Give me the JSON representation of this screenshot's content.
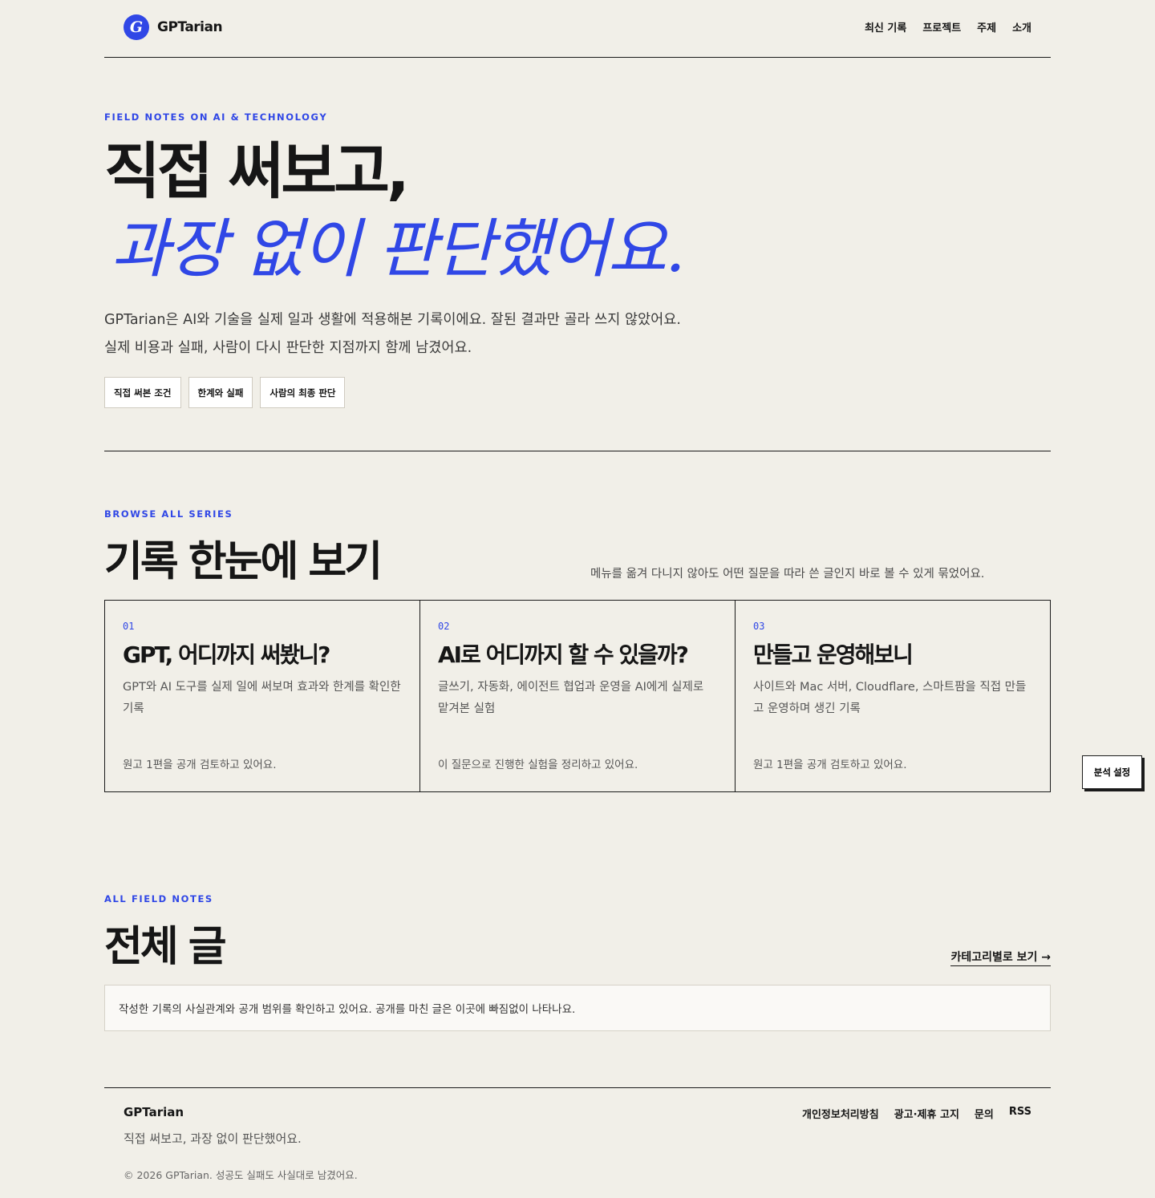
{
  "brand": {
    "logo_letter": "G",
    "name": "GPTarian",
    "accent": "#3047e6"
  },
  "nav": [
    "최신 기록",
    "프로젝트",
    "주제",
    "소개"
  ],
  "hero": {
    "eyebrow": "FIELD NOTES ON AI & TECHNOLOGY",
    "title_line1": "직접 써보고,",
    "title_line2": "과장 없이 판단했어요.",
    "desc_line1": "GPTarian은 AI와 기술을 실제 일과 생활에 적용해본 기록이에요. 잘된 결과만 골라 쓰지 않았어요.",
    "desc_line2": "실제 비용과 실패, 사람이 다시 판단한 지점까지 함께 남겼어요.",
    "chips": [
      "직접 써본 조건",
      "한계와 실패",
      "사람의 최종 판단"
    ]
  },
  "series": {
    "eyebrow": "BROWSE ALL SERIES",
    "title": "기록 한눈에 보기",
    "note": "메뉴를 옮겨 다니지 않아도 어떤 질문을 따라 쓴 글인지 바로 볼 수 있게 묶었어요.",
    "cards": [
      {
        "num": "01",
        "title": "GPT, 어디까지 써봤니?",
        "desc": "GPT와 AI 도구를 실제 일에 써보며 효과와 한계를 확인한 기록",
        "status": "원고 1편을 공개 검토하고 있어요."
      },
      {
        "num": "02",
        "title": "AI로 어디까지 할 수 있을까?",
        "desc": "글쓰기, 자동화, 에이전트 협업과 운영을 AI에게 실제로 맡겨본 실험",
        "status": "이 질문으로 진행한 실험을 정리하고 있어요."
      },
      {
        "num": "03",
        "title": "만들고 운영해보니",
        "desc": "사이트와 Mac 서버, Cloudflare, 스마트팜을 직접 만들고 운영하며 생긴 기록",
        "status": "원고 1편을 공개 검토하고 있어요."
      }
    ]
  },
  "analytics_button": "분석 설정",
  "notes": {
    "eyebrow": "ALL FIELD NOTES",
    "title": "전체 글",
    "category_link": "카테고리별로 보기 →",
    "message": "작성한 기록의 사실관계와 공개 범위를 확인하고 있어요. 공개를 마친 글은 이곳에 빠짐없이 나타나요."
  },
  "footer": {
    "brand": "GPTarian",
    "tagline": "직접 써보고, 과장 없이 판단했어요.",
    "copyright": "© 2026 GPTarian. 성공도 실패도 사실대로 남겼어요.",
    "links": [
      "개인정보처리방침",
      "광고·제휴 고지",
      "문의",
      "RSS"
    ]
  }
}
